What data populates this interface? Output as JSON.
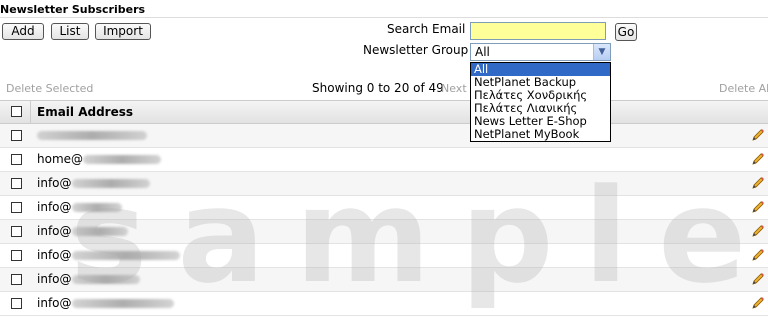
{
  "page_title": "Newsletter Subscribers",
  "toolbar": {
    "add_label": "Add",
    "list_label": "List",
    "import_label": "Import"
  },
  "search": {
    "label": "Search Email",
    "value": "",
    "go_label": "Go"
  },
  "group": {
    "label": "Newsletter Group",
    "selected": "All",
    "options": [
      "All",
      "NetPlanet Backup",
      "Πελάτες Χονδρικής",
      "Πελάτες Λιανικής",
      "News Letter E-Shop",
      "NetPlanet MyBook"
    ]
  },
  "actions": {
    "delete_selected": "Delete Selected",
    "delete_all": "Delete All"
  },
  "pagination": {
    "showing": "Showing 0 to 20 of 49",
    "next": "Next"
  },
  "table": {
    "header": "Email Address",
    "rows": [
      {
        "prefix": ""
      },
      {
        "prefix": "home@"
      },
      {
        "prefix": "info@"
      },
      {
        "prefix": "info@"
      },
      {
        "prefix": "info@"
      },
      {
        "prefix": "info@"
      },
      {
        "prefix": "info@"
      },
      {
        "prefix": "info@"
      }
    ]
  },
  "watermark": "sample",
  "icons": {
    "edit": "pencil-icon",
    "dropdown": "chevron-down-icon"
  }
}
